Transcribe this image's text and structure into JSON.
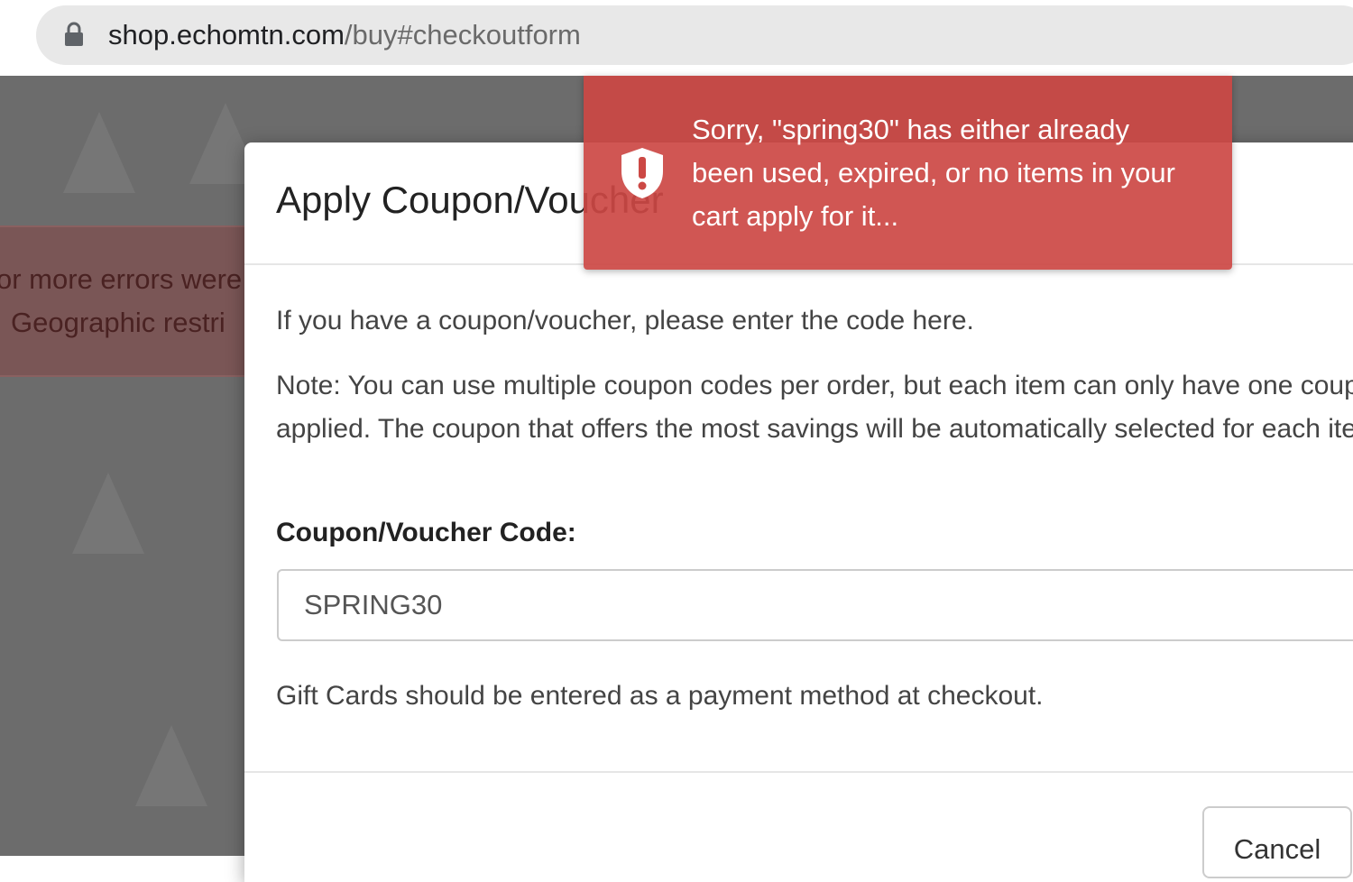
{
  "browser": {
    "url_host": "shop.echomtn.com",
    "url_path": "/buy#checkoutform"
  },
  "background_page": {
    "error_line_1": "or more errors were",
    "error_line_2": "Geographic restri"
  },
  "modal": {
    "title": "Apply Coupon/Voucher",
    "intro": "If you have a coupon/voucher, please enter the code here.",
    "note": "Note: You can use multiple coupon codes per order, but each item can only have one coupon applied. The coupon that offers the most savings will be automatically selected for each item.",
    "field_label": "Coupon/Voucher Code:",
    "coupon_value": "SPRING30",
    "gift_card_note": "Gift Cards should be entered as a payment method at checkout.",
    "cancel_label": "Cancel"
  },
  "toast": {
    "message": "Sorry, \"spring30\" has either already been used, expired, or no items in your cart apply for it..."
  },
  "colors": {
    "toast_bg": "#cc4844",
    "overlay": "#6c6c6c",
    "error_panel": "#7a5656"
  }
}
